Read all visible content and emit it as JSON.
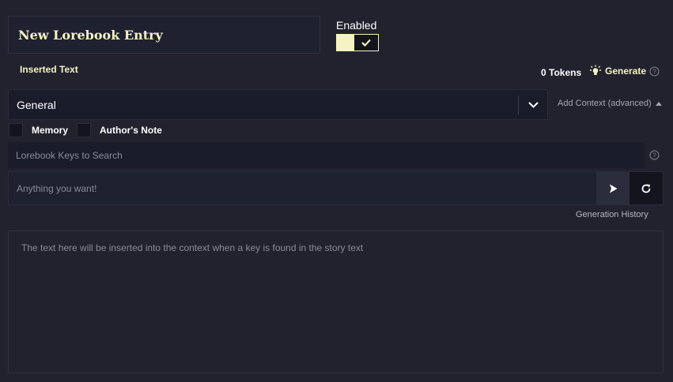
{
  "entry": {
    "title": "New Lorebook Entry",
    "enabled_label": "Enabled",
    "enabled": true,
    "inserted_text_label": "Inserted Text"
  },
  "tokens": {
    "label": "0 Tokens"
  },
  "generate": {
    "label": "Generate",
    "icon": "lightbulb-icon"
  },
  "context_select": {
    "value": "General"
  },
  "add_context": {
    "label": "Add Context (advanced)"
  },
  "checkboxes": {
    "memory_label": "Memory",
    "authors_note_label": "Author's Note"
  },
  "keys_search": {
    "placeholder": "Lorebook Keys to Search"
  },
  "generator": {
    "placeholder": "Anything you want!",
    "history_label": "Generation History"
  },
  "text": {
    "placeholder": "The text here will be inserted into the context when a key is found in the story text"
  },
  "colors": {
    "background": "#22222f",
    "accent": "#f5f3c2",
    "panel": "#1b1c2a",
    "dark": "#13141d"
  }
}
